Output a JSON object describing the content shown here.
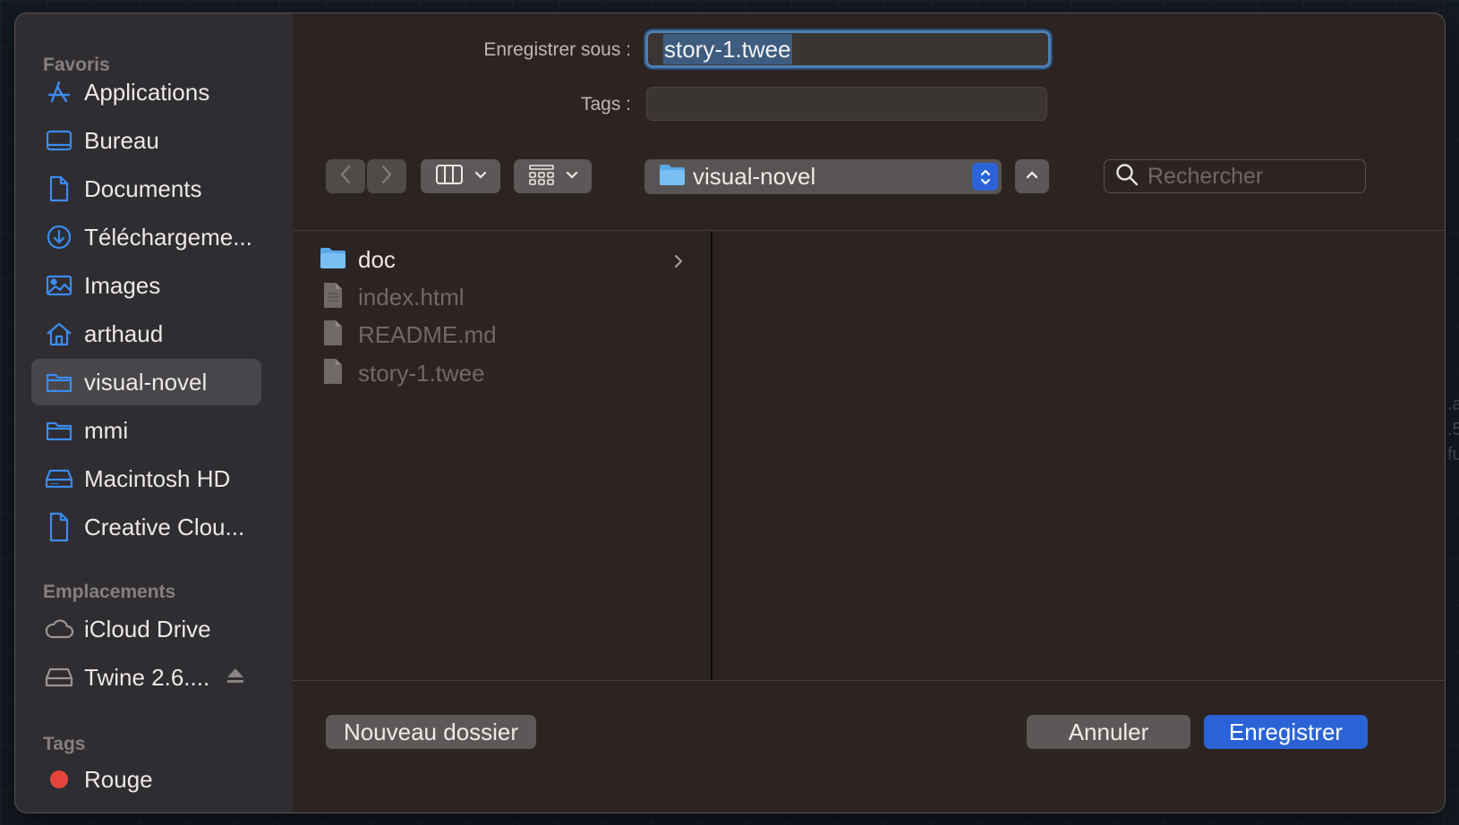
{
  "background_fragments": [
    ".ac",
    ".5",
    "fu"
  ],
  "sidebar": {
    "favorites_header": "Favoris",
    "favorites": [
      {
        "label": "Applications",
        "icon": "applications-icon"
      },
      {
        "label": "Bureau",
        "icon": "desktop-icon"
      },
      {
        "label": "Documents",
        "icon": "document-icon"
      },
      {
        "label": "Téléchargeme...",
        "icon": "download-icon"
      },
      {
        "label": "Images",
        "icon": "photo-icon"
      },
      {
        "label": "arthaud",
        "icon": "home-icon"
      },
      {
        "label": "visual-novel",
        "icon": "folder-icon",
        "selected": true
      },
      {
        "label": "mmi",
        "icon": "folder-icon"
      },
      {
        "label": "Macintosh HD",
        "icon": "drive-icon"
      },
      {
        "label": "Creative Clou...",
        "icon": "document-icon"
      }
    ],
    "locations_header": "Emplacements",
    "locations": [
      {
        "label": "iCloud Drive",
        "icon": "cloud-icon"
      },
      {
        "label": "Twine 2.6....",
        "icon": "drive-icon",
        "ejectable": true
      }
    ],
    "tags_header": "Tags",
    "tags": [
      {
        "label": "Rouge",
        "color": "#e5443a"
      }
    ]
  },
  "form": {
    "save_as_label": "Enregistrer sous :",
    "save_as_value": "story-1.twee",
    "tags_label": "Tags :",
    "tags_value": ""
  },
  "toolbar": {
    "location": "visual-novel",
    "search_placeholder": "Rechercher"
  },
  "browser": {
    "items": [
      {
        "name": "doc",
        "type": "folder",
        "enabled": true
      },
      {
        "name": "index.html",
        "type": "file",
        "enabled": false
      },
      {
        "name": "README.md",
        "type": "file",
        "enabled": false
      },
      {
        "name": "story-1.twee",
        "type": "file",
        "enabled": false
      }
    ]
  },
  "buttons": {
    "new_folder": "Nouveau dossier",
    "cancel": "Annuler",
    "save": "Enregistrer"
  },
  "colors": {
    "accent": "#2b63d6",
    "sidebar_icon": "#3b8cf0",
    "tag_red": "#e5443a"
  }
}
